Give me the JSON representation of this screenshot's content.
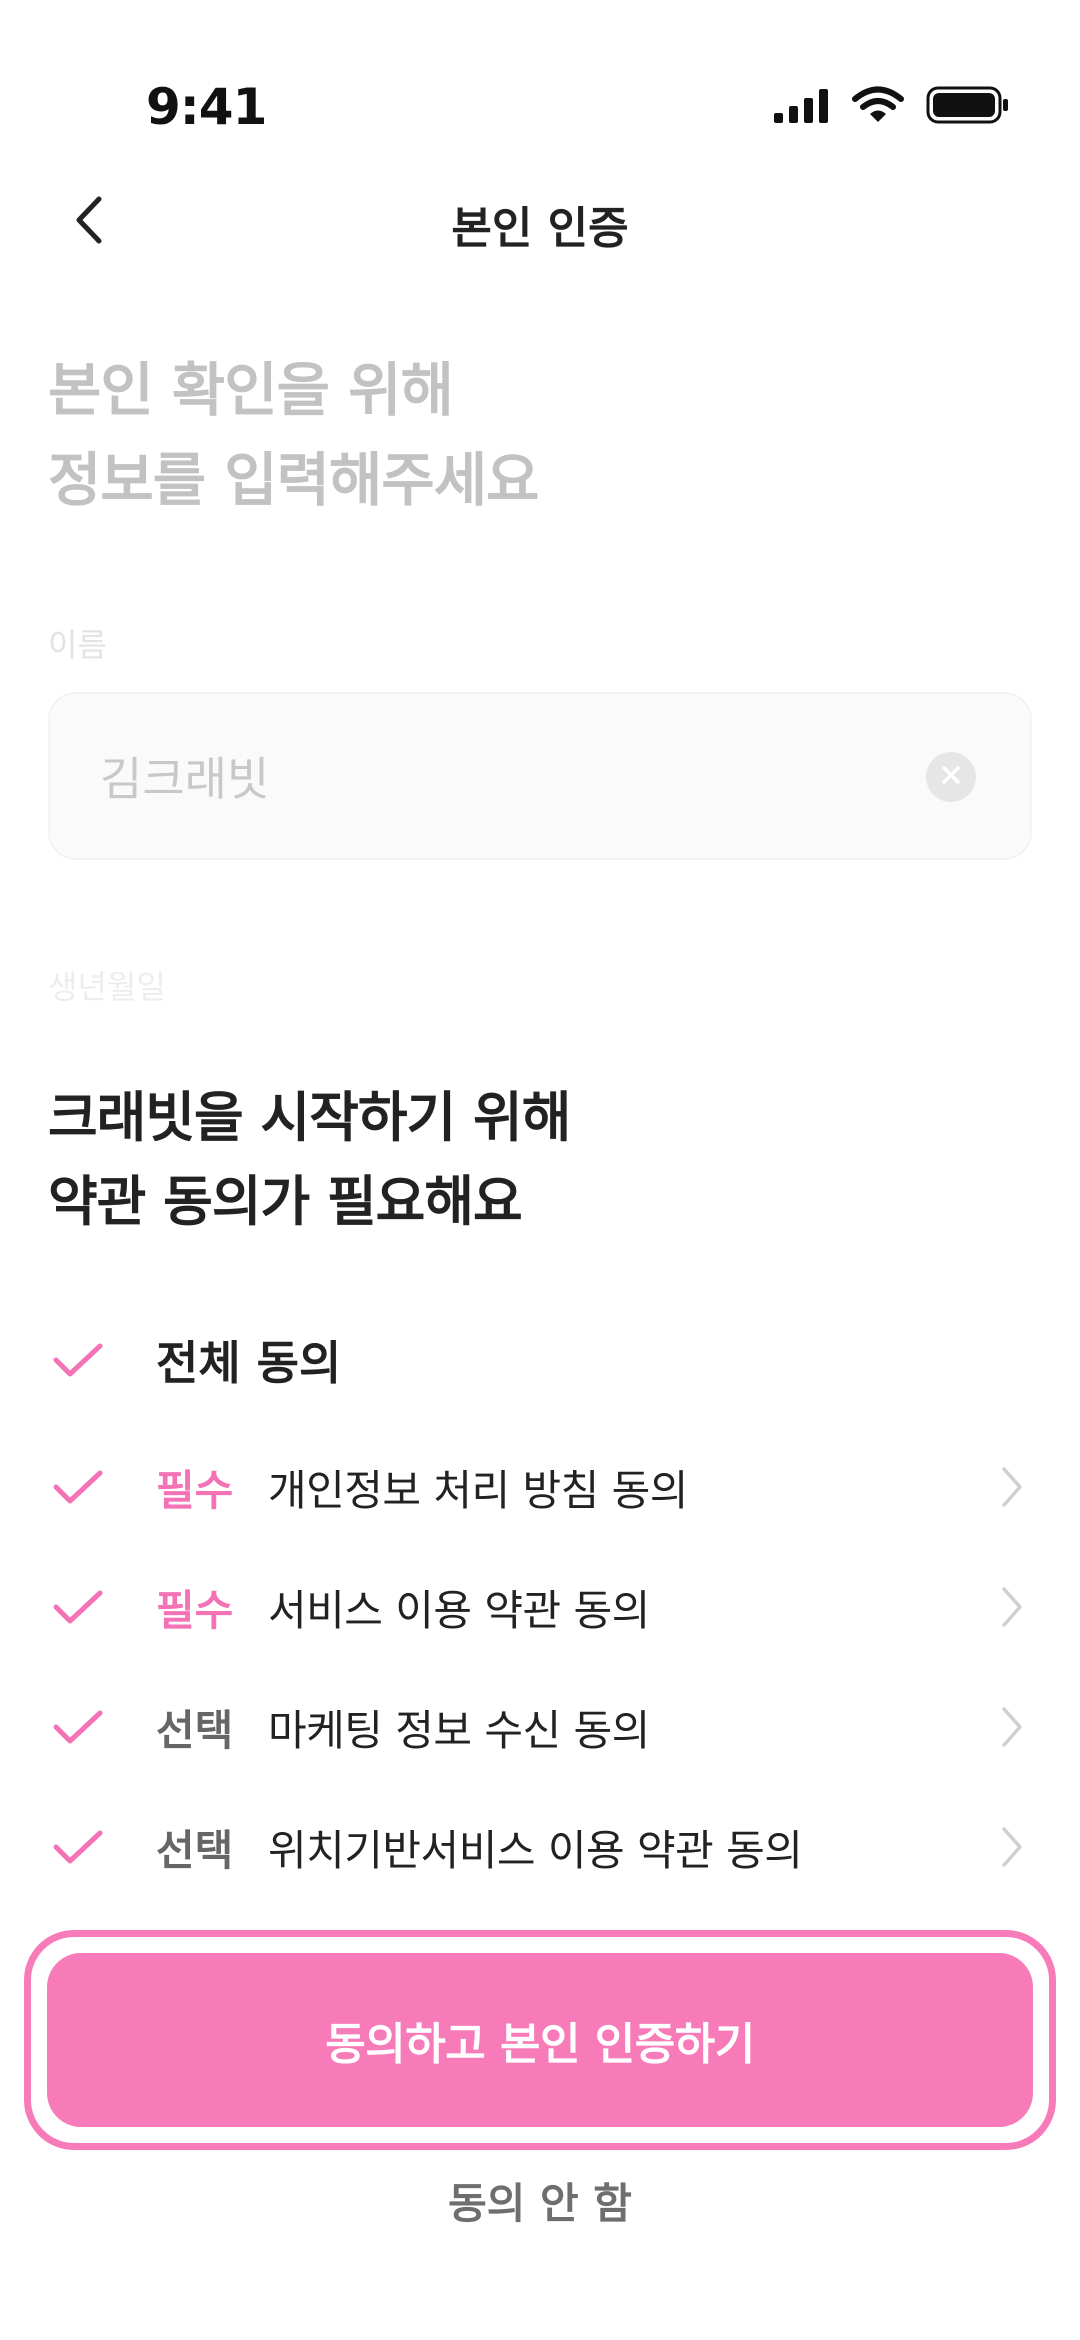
{
  "status_bar": {
    "time": "9:41",
    "icons": [
      "signal-icon",
      "wifi-icon",
      "battery-icon"
    ]
  },
  "nav": {
    "title": "본인 인증",
    "back_icon": "chevron-left-icon"
  },
  "form": {
    "heading_line1": "본인 확인을 위해",
    "heading_line2": "정보를 입력해주세요",
    "name_label": "이름",
    "name_value": "김크래빗",
    "birth_label": "생년월일"
  },
  "terms_sheet": {
    "heading_line1": "크래빗을 시작하기 위해",
    "heading_line2": "약관 동의가 필요해요",
    "all_agree_label": "전체 동의",
    "items": [
      {
        "tag": "필수",
        "text": "개인정보 처리 방침 동의",
        "checked": true
      },
      {
        "tag": "필수",
        "text": "서비스 이용 약관 동의",
        "checked": true
      },
      {
        "tag": "선택",
        "text": "마케팅 정보 수신 동의",
        "checked": true
      },
      {
        "tag": "선택",
        "text": "위치기반서비스 이용 약관 동의",
        "checked": true
      }
    ],
    "agree_button_label": "동의하고 본인 인증하기",
    "decline_label": "동의 안 함"
  },
  "colors": {
    "accent": "#f77ab9",
    "required_tag": "#f472b6",
    "check": "#f472b6"
  }
}
